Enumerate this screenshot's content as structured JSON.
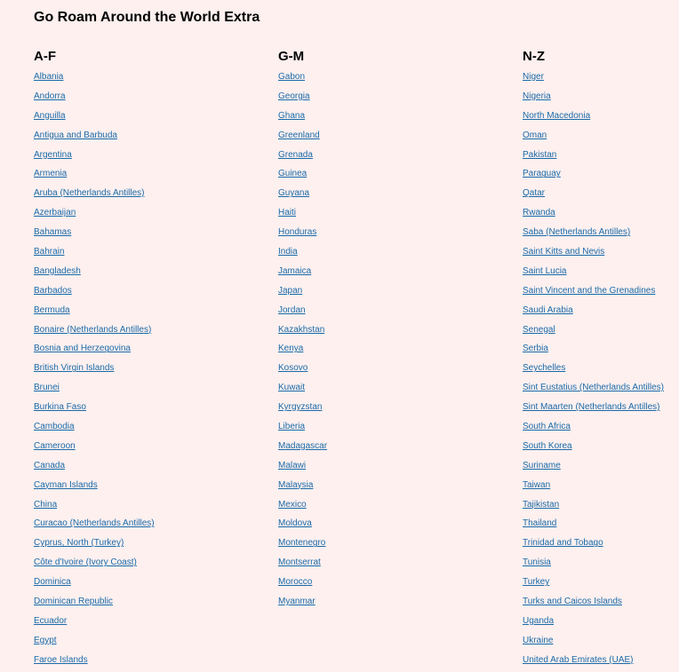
{
  "page": {
    "title": "Go Roam Around the World Extra"
  },
  "columns": [
    {
      "heading": "A-F",
      "countries": [
        "Albania",
        "Andorra",
        "Anguilla",
        "Antigua and Barbuda",
        "Argentina",
        "Armenia",
        "Aruba (Netherlands Antilles)",
        "Azerbaijan",
        "Bahamas",
        "Bahrain",
        "Bangladesh",
        "Barbados",
        "Bermuda",
        "Bonaire (Netherlands Antilles)",
        "Bosnia and Herzegovina",
        "British Virgin Islands",
        "Brunei",
        "Burkina Faso",
        "Cambodia",
        "Cameroon",
        "Canada",
        "Cayman Islands",
        "China",
        "Curacao (Netherlands Antilles)",
        "Cyprus, North (Turkey)",
        "Côte d'Ivoire (Ivory Coast)",
        "Dominica",
        "Dominican Republic",
        "Ecuador",
        "Egypt",
        "Faroe Islands"
      ]
    },
    {
      "heading": "G-M",
      "countries": [
        "Gabon",
        "Georgia",
        "Ghana",
        "Greenland",
        "Grenada",
        "Guinea",
        "Guyana",
        "Haiti",
        "Honduras",
        "India",
        "Jamaica",
        "Japan",
        "Jordan",
        "Kazakhstan",
        "Kenya",
        "Kosovo",
        "Kuwait",
        "Kyrgyzstan",
        "Liberia",
        "Madagascar",
        "Malawi",
        "Malaysia",
        "Mexico",
        "Moldova",
        "Montenegro",
        "Montserrat",
        "Morocco",
        "Myanmar"
      ]
    },
    {
      "heading": "N-Z",
      "countries": [
        "Niger",
        "Nigeria",
        "North Macedonia",
        "Oman",
        "Pakistan",
        "Paraguay",
        "Qatar",
        "Rwanda",
        "Saba (Netherlands Antilles)",
        "Saint Kitts and Nevis",
        "Saint Lucia",
        "Saint Vincent and the Grenadines",
        "Saudi Arabia",
        "Senegal",
        "Serbia",
        "Seychelles",
        "Sint Eustatius (Netherlands Antilles)",
        "Sint Maarten (Netherlands Antilles)",
        "South Africa",
        "South Korea",
        "Suriname",
        "Taiwan",
        "Tajikistan",
        "Thailand",
        "Trinidad and Tobago",
        "Tunisia",
        "Turkey",
        "Turks and Caicos Islands",
        "Uganda",
        "Ukraine",
        "United Arab Emirates (UAE)"
      ]
    }
  ],
  "colors": {
    "background": "#fdf0ef",
    "link": "#1a6aa8",
    "heading": "#000000"
  }
}
